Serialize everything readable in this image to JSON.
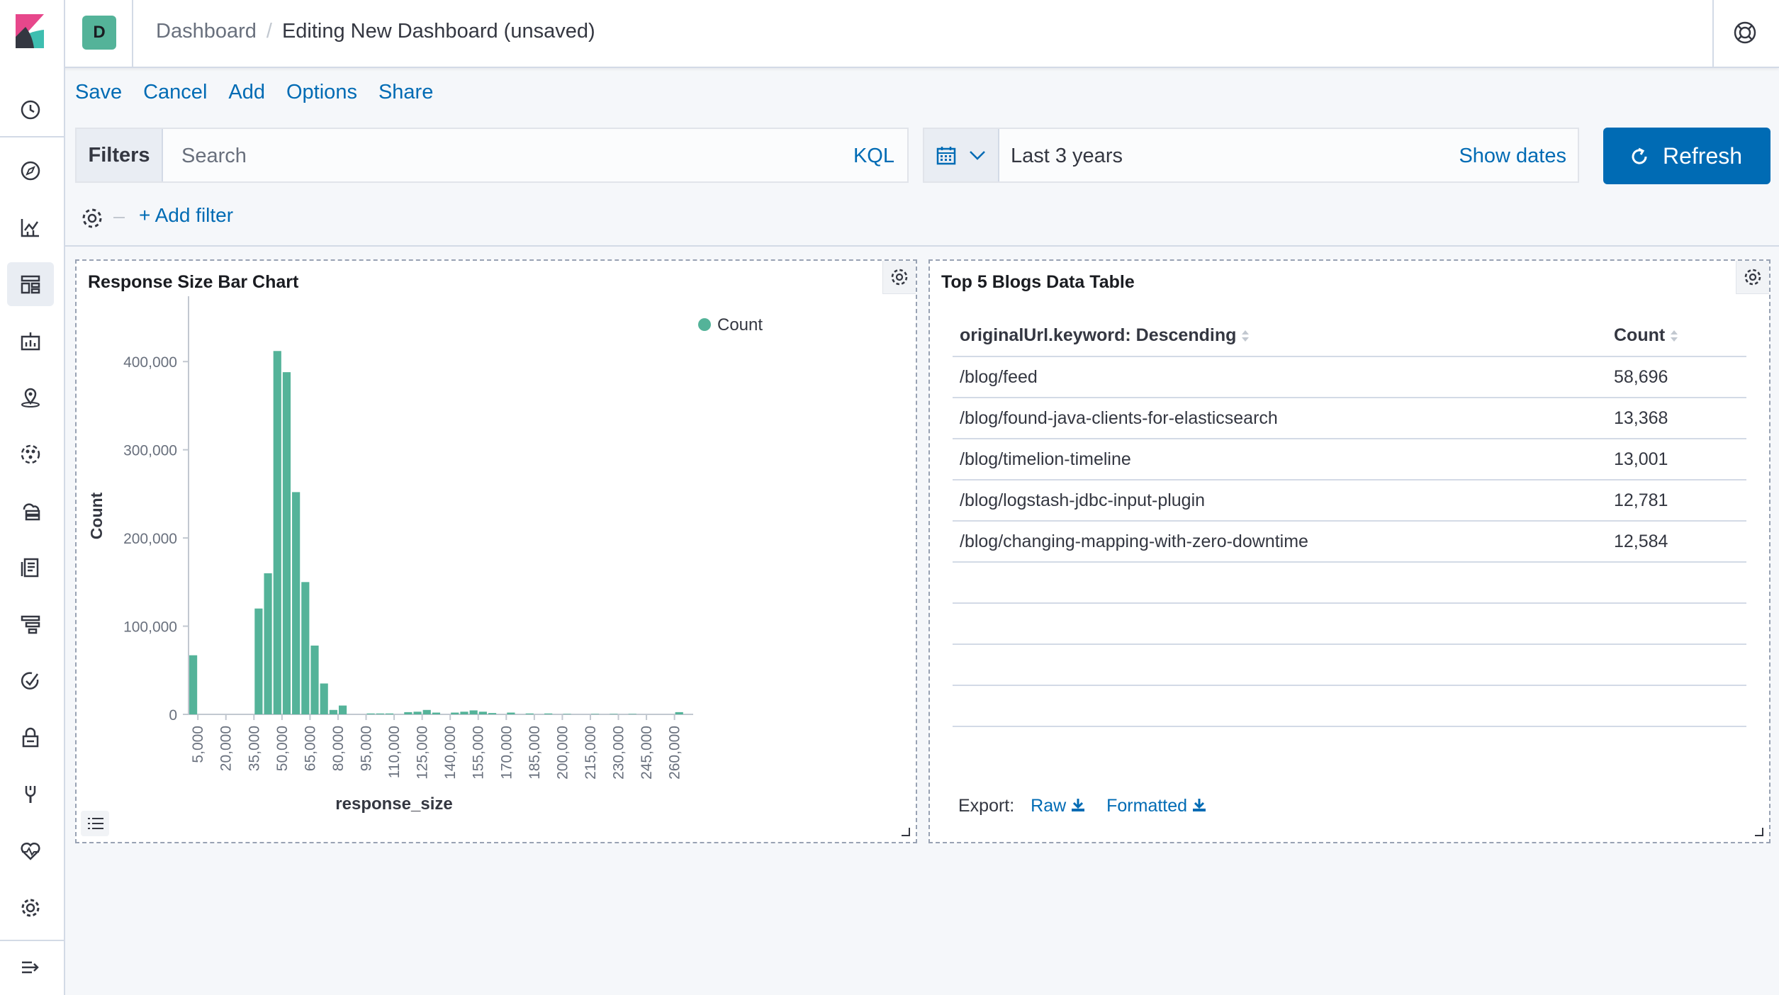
{
  "header": {
    "space_initial": "D",
    "breadcrumbs": [
      "Dashboard",
      "Editing New Dashboard (unsaved)"
    ],
    "separator": "/"
  },
  "sidenav": {
    "items": [
      "recently-viewed-icon",
      "discover-icon",
      "visualize-icon",
      "dashboard-icon",
      "canvas-icon",
      "maps-icon",
      "ml-icon",
      "infrastructure-icon",
      "logs-icon",
      "apm-icon",
      "uptime-icon",
      "siem-icon",
      "dev-tools-icon",
      "monitoring-icon",
      "management-icon",
      "collapse-icon"
    ],
    "active": "dashboard-icon"
  },
  "topmenu": {
    "items": [
      "Save",
      "Cancel",
      "Add",
      "Options",
      "Share"
    ]
  },
  "querybar": {
    "filters_label": "Filters",
    "search_placeholder": "Search",
    "language": "KQL"
  },
  "datepicker": {
    "range": "Last 3 years",
    "show_dates": "Show dates"
  },
  "refresh": {
    "label": "Refresh"
  },
  "filterbar": {
    "add_filter": "+ Add filter"
  },
  "panels": {
    "bar_chart": {
      "title": "Response Size Bar Chart"
    },
    "data_table": {
      "title": "Top 5 Blogs Data Table",
      "columns": [
        "originalUrl.keyword: Descending",
        "Count"
      ],
      "rows": [
        [
          "/blog/feed",
          "58,696"
        ],
        [
          "/blog/found-java-clients-for-elasticsearch",
          "13,368"
        ],
        [
          "/blog/timelion-timeline",
          "13,001"
        ],
        [
          "/blog/logstash-jdbc-input-plugin",
          "12,781"
        ],
        [
          "/blog/changing-mapping-with-zero-downtime",
          "12,584"
        ]
      ],
      "export_label": "Export:",
      "export_raw": "Raw",
      "export_formatted": "Formatted"
    }
  },
  "colors": {
    "accent": "#006bb4",
    "bar": "#54b399",
    "logo_pink": "#e7478b",
    "logo_teal": "#3ebeb0",
    "logo_dark": "#343741"
  },
  "chart_data": {
    "type": "bar",
    "title": "",
    "xlabel": "response_size",
    "ylabel": "Count",
    "legend": [
      "Count"
    ],
    "legend_position": "top-right",
    "grid": false,
    "xlim": [
      0,
      270000
    ],
    "ylim": [
      0,
      450000
    ],
    "interval": 5000,
    "x_ticks": [
      "5,000",
      "20,000",
      "35,000",
      "50,000",
      "65,000",
      "80,000",
      "95,000",
      "110,000",
      "125,000",
      "140,000",
      "155,000",
      "170,000",
      "185,000",
      "200,000",
      "215,000",
      "230,000",
      "245,000",
      "260,000"
    ],
    "y_ticks": [
      "0",
      "100,000",
      "200,000",
      "300,000",
      "400,000"
    ],
    "series": [
      {
        "name": "Count",
        "x": [
          0,
          35000,
          40000,
          45000,
          50000,
          55000,
          60000,
          65000,
          70000,
          75000,
          80000,
          95000,
          100000,
          105000,
          115000,
          120000,
          125000,
          130000,
          140000,
          145000,
          150000,
          155000,
          160000,
          170000,
          180000,
          190000,
          200000,
          215000,
          225000,
          235000,
          260000
        ],
        "values": [
          67000,
          120000,
          160000,
          412000,
          388000,
          252000,
          150000,
          78000,
          35000,
          5000,
          10000,
          1000,
          1000,
          1000,
          2500,
          3000,
          5000,
          2000,
          2000,
          3000,
          4500,
          3000,
          1500,
          2000,
          1000,
          1000,
          500,
          500,
          500,
          500,
          2500
        ]
      }
    ]
  }
}
